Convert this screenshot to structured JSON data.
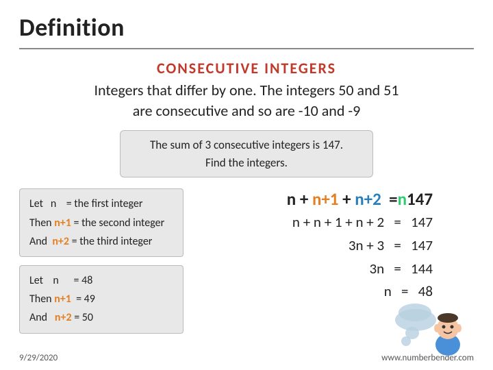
{
  "page": {
    "title": "Definition",
    "divider": true,
    "heading": "CONSECUTIVE INTEGERS",
    "definition": "Integers that differ by one. The integers 50 and 51\nare consecutive and so are -10 and -9",
    "problem_box": {
      "line1": "The sum of 3 consecutive integers is 147.",
      "line2": "Find the integers."
    },
    "var_definitions": {
      "line1": "Let   n     = the first integer",
      "line2": "Then n+1 = the second integer",
      "line3": "And  n+2 = the third integer"
    },
    "solution_box": {
      "line1": "Let    n      = 48",
      "line2": "Then n+1  = 49",
      "line3": "And   n+2 = 50"
    },
    "equations": {
      "eq1_prefix": "n + n+1 + n+2",
      "eq1_suffix": "= 147",
      "eq2": "n + n + 1 + n + 2  =  147",
      "eq3": "3n + 3  =  147",
      "eq4": "3n  =  144",
      "eq5": "n  =  48"
    },
    "footer": {
      "date": "9/29/2020",
      "url": "www.numberbender.com"
    }
  }
}
